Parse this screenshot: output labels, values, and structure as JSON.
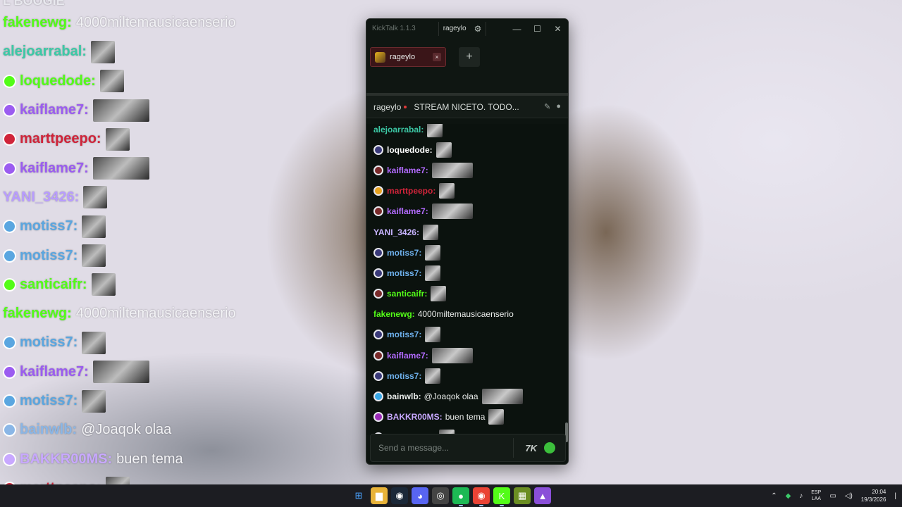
{
  "colors": {
    "green": "#53fc18",
    "purple": "#9b5cf0",
    "crimson": "#d0243a",
    "blue": "#5aa6e0",
    "lavender": "#c8a8ff",
    "teal": "#3cc9a6"
  },
  "overlay": {
    "top_cut_name": "L BOOGIE",
    "lines": [
      {
        "name": "fakenewg:",
        "msg": "4000miltemausicaenserio",
        "color": "#53fc18"
      },
      {
        "name": "alejoarrabal:",
        "msg": "",
        "color": "#3cc9a6"
      },
      {
        "name": "loquedode:",
        "msg": "",
        "color": "#53fc18"
      },
      {
        "name": "kaiflame7:",
        "msg": "",
        "color": "#9b5cf0"
      },
      {
        "name": "marttpeepo:",
        "msg": "",
        "color": "#d0243a"
      },
      {
        "name": "kaiflame7:",
        "msg": "",
        "color": "#9b5cf0"
      },
      {
        "name": "YANI_3426:",
        "msg": "",
        "color": "#b89cff"
      },
      {
        "name": "motiss7:",
        "msg": "",
        "color": "#5aa6e0"
      },
      {
        "name": "motiss7:",
        "msg": "",
        "color": "#5aa6e0"
      },
      {
        "name": "santicaifr:",
        "msg": "",
        "color": "#53fc18"
      },
      {
        "name": "fakenewg:",
        "msg": "4000miltemausicaenserio",
        "color": "#53fc18"
      },
      {
        "name": "motiss7:",
        "msg": "",
        "color": "#5aa6e0"
      },
      {
        "name": "kaiflame7:",
        "msg": "",
        "color": "#9b5cf0"
      },
      {
        "name": "motiss7:",
        "msg": "",
        "color": "#5aa6e0"
      },
      {
        "name": "bainwlb:",
        "msg": "@Joaqok olaa",
        "color": "#8ab6e6"
      },
      {
        "name": "BAKKR00MS:",
        "msg": "buen tema",
        "color": "#c8a8ff"
      },
      {
        "name": "marttpeepo:",
        "msg": "",
        "color": "#d0243a"
      }
    ]
  },
  "kicktalk": {
    "app_title": "KickTalk 1.1.3",
    "user": "rageylo",
    "window_controls": {
      "minimize": "—",
      "maximize": "☐",
      "close": "✕"
    },
    "tab": {
      "label": "rageylo",
      "close": "×"
    },
    "add_tab": "+",
    "stream": {
      "streamer": "rageylo",
      "title": "STREAM NICETO. TODO..."
    },
    "messages": [
      {
        "name": "alejoarrabal:",
        "text": "",
        "color": "#3cc9a6",
        "badge": ""
      },
      {
        "name": "loquedode:",
        "text": "",
        "color": "#ffffff",
        "badge": "#3a3a7a"
      },
      {
        "name": "kaiflame7:",
        "text": "",
        "color": "#b36bff",
        "badge": "#7a2a2a"
      },
      {
        "name": "marttpeepo:",
        "text": "",
        "color": "#d0243a",
        "badge": "#e6a21e"
      },
      {
        "name": "kaiflame7:",
        "text": "",
        "color": "#b36bff",
        "badge": "#7a2a2a"
      },
      {
        "name": "YANI_3426:",
        "text": "",
        "color": "#c8b4ff",
        "badge": ""
      },
      {
        "name": "motiss7:",
        "text": "",
        "color": "#6fb2ee",
        "badge": "#3a3a7a"
      },
      {
        "name": "motiss7:",
        "text": "",
        "color": "#6fb2ee",
        "badge": "#3a3a7a"
      },
      {
        "name": "santicaifr:",
        "text": "",
        "color": "#53fc18",
        "badge": "#7a2a2a"
      },
      {
        "name": "fakenewg:",
        "text": "4000miltemausicaenserio",
        "color": "#53fc18",
        "badge": ""
      },
      {
        "name": "motiss7:",
        "text": "",
        "color": "#6fb2ee",
        "badge": "#3a3a7a"
      },
      {
        "name": "kaiflame7:",
        "text": "",
        "color": "#b36bff",
        "badge": "#7a2a2a"
      },
      {
        "name": "motiss7:",
        "text": "",
        "color": "#6fb2ee",
        "badge": "#3a3a7a"
      },
      {
        "name": "bainwlb:",
        "text": "@Joaqok olaa",
        "color": "#e9ecea",
        "badge": "#39a8e6"
      },
      {
        "name": "BAKKR00MS:",
        "text": "buen tema",
        "color": "#c8a8ff",
        "badge": "#9b2bb8"
      },
      {
        "name": "marttpeepo:",
        "text": "",
        "color": "#d0243a",
        "badge": "#e6a21e"
      }
    ],
    "input_placeholder": "Send a message..."
  },
  "taskbar": {
    "apps": [
      "start-icon",
      "file-explorer-icon",
      "steam-icon",
      "discord-icon",
      "obs-icon",
      "spotify-icon",
      "chrome-icon",
      "kick-icon",
      "minecraft-icon",
      "lutris-icon"
    ],
    "lang_top": "ESP",
    "lang_bottom": "LAA",
    "time": "20:04",
    "date": "19/3/2026"
  }
}
